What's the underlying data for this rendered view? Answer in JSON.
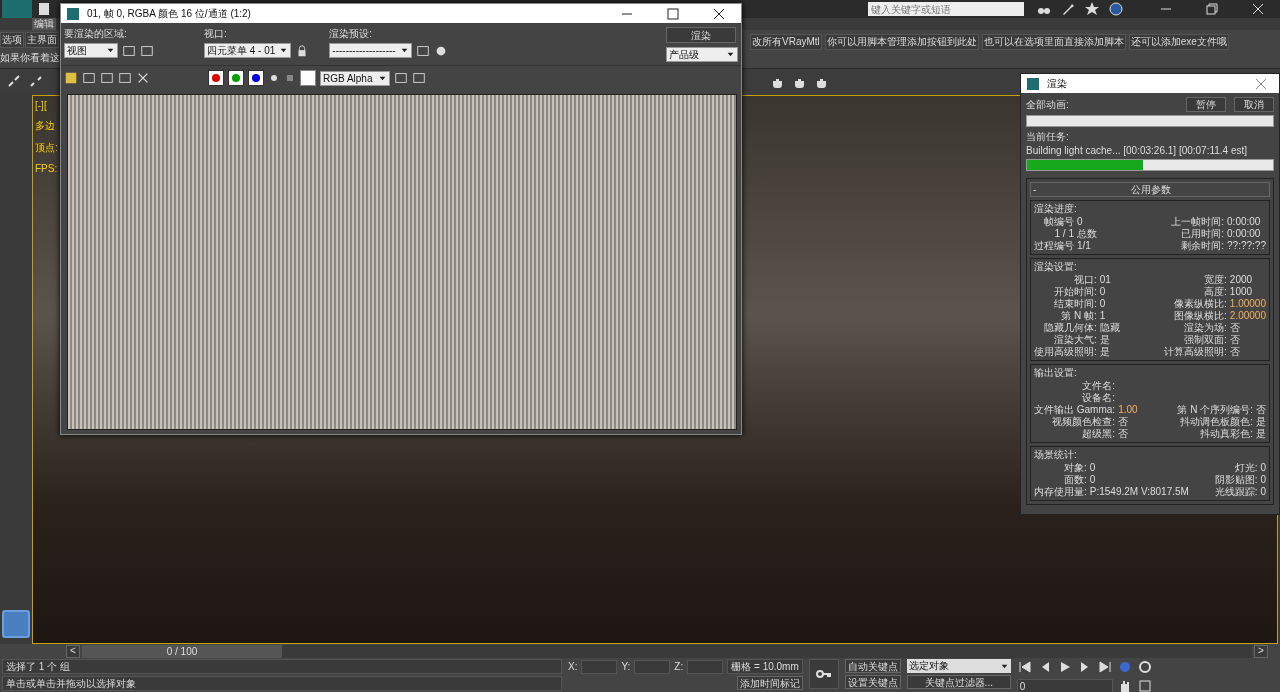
{
  "app_title_bar": {
    "search_placeholder": "键入关键字或短语"
  },
  "menu_bar": {
    "items": [
      "编辑"
    ]
  },
  "script_bar": {
    "left_buttons": [
      "选项",
      "主界面"
    ],
    "left_note": "如果你看着这",
    "right_buttons": [
      "改所有VRayMtl",
      "你可以用脚本管理添加按钮到此处",
      "也可以在选项里面直接添加脚本",
      "还可以添加exe文件哦"
    ]
  },
  "viewport": {
    "label": "[-][",
    "stats": [
      "多边",
      "顶点:",
      "FPS:"
    ]
  },
  "timeline": {
    "prev": "<",
    "position": "0 / 100",
    "level": 0,
    "next": ">"
  },
  "status": {
    "selection": "选择了 1 个 组",
    "prompt": "单击或单击并拖动以选择对象",
    "coords": [
      "X:",
      "Y:",
      "Z:"
    ],
    "grid": "栅格 = 10.0mm",
    "add_time_tag": "添加时间标记",
    "auto_key": "自动关键点",
    "set_key": "设置关键点",
    "key_target": "选定对象",
    "key_filters": "关键点过滤器...",
    "frame": "0"
  },
  "render_frame": {
    "title": "01, 帧 0, RGBA 颜色 16 位/通道 (1:2)",
    "area_label": "要渲染的区域:",
    "area_value": "视图",
    "viewport_label": "视口:",
    "viewport_value": "四元菜单 4 - 01",
    "preset_label": "渲染预设:",
    "preset_value": "-------------------",
    "render_button": "渲染",
    "quality": "产品级",
    "channels": [
      {
        "color": "#e00000"
      },
      {
        "color": "#00a000"
      },
      {
        "color": "#0000e0"
      }
    ],
    "display": "RGB Alpha"
  },
  "render_dialog": {
    "title": "渲染",
    "all_label": "全部动画:",
    "all_progress": {
      "level": 0
    },
    "pause": "暂停",
    "cancel": "取消",
    "task_label": "当前任务:",
    "task": "Building light cache... [00:03:26.1] [00:07:11.4 est]",
    "task_progress": {
      "level": 0.47
    },
    "collapse": "-",
    "panel_title": "公用参数",
    "groups": [
      {
        "title": "渲染进度:",
        "rows": [
          {
            "left": {
              "label": "帧编号",
              "value": "0"
            },
            "right": {
              "label": "上一帧时间:",
              "value": "0:00:00"
            }
          },
          {
            "left": {
              "label": "1 / 1",
              "value": "总数"
            },
            "right": {
              "label": "已用时间:",
              "value": "0:00:00"
            }
          },
          {
            "left": {
              "label": "过程编号",
              "value": "1/1"
            },
            "right": {
              "label": "剩余时间:",
              "value": "??:??:??"
            }
          }
        ]
      },
      {
        "title": "渲染设置:",
        "rows": [
          {
            "left": {
              "label": "视口:",
              "value": "01"
            },
            "right": {
              "label": "宽度:",
              "value": "2000"
            }
          },
          {
            "left": {
              "label": "开始时间:",
              "value": "0"
            },
            "right": {
              "label": "高度:",
              "value": "1000"
            }
          },
          {
            "left": {
              "label": "结束时间:",
              "value": "0"
            },
            "right": {
              "label": "像素纵横比:",
              "value": "1.00000",
              "accent": true
            }
          },
          {
            "left": {
              "label": "第 N 帧:",
              "value": "1"
            },
            "right": {
              "label": "图像纵横比:",
              "value": "2.00000",
              "accent": true
            }
          },
          {
            "left": {
              "label": "隐藏几何体:",
              "value": "隐藏"
            },
            "right": {
              "label": "渲染为场:",
              "value": "否"
            }
          },
          {
            "left": {
              "label": "渲染大气:",
              "value": "是"
            },
            "right": {
              "label": "强制双面:",
              "value": "否"
            }
          },
          {
            "left": {
              "label": "使用高级照明:",
              "value": "是"
            },
            "right": {
              "label": "计算高级照明:",
              "value": "否"
            }
          }
        ]
      },
      {
        "title": "输出设置:",
        "rows": [
          {
            "left": {
              "label": "文件名:"
            }
          },
          {
            "left": {
              "label": "设备名:"
            }
          },
          {
            "left": {
              "label": "文件输出 Gamma:",
              "value": "1.00",
              "accent": true
            },
            "right": {
              "label": "第 N 个序列编号:",
              "value": "否"
            }
          },
          {
            "left": {
              "label": "视频颜色检查:",
              "value": "否"
            },
            "right": {
              "label": "抖动调色板颜色:",
              "value": "是"
            }
          },
          {
            "left": {
              "label": "超级黑:",
              "value": "否"
            },
            "right": {
              "label": "抖动真彩色:",
              "value": "是"
            }
          }
        ]
      },
      {
        "title": "场景统计:",
        "rows": [
          {
            "left": {
              "label": "对象:",
              "value": "0"
            },
            "right": {
              "label": "灯光:",
              "value": "0"
            }
          },
          {
            "left": {
              "label": "面数:",
              "value": "0"
            },
            "right": {
              "label": "阴影贴图:",
              "value": "0"
            }
          },
          {
            "left": {
              "label": "内存使用量:",
              "value": "P:1549.2M V:8017.5M"
            },
            "right": {
              "label": "光线跟踪:",
              "value": "0"
            }
          }
        ]
      }
    ]
  }
}
